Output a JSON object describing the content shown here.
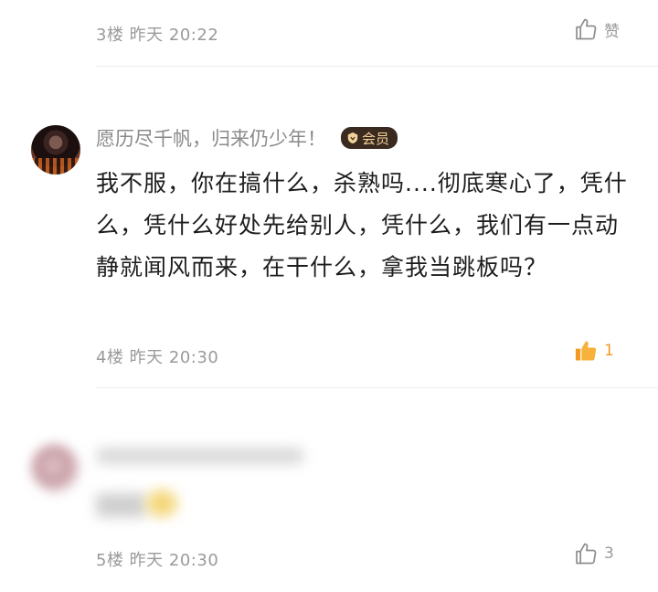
{
  "comments": [
    {
      "floor_time": "3楼 昨天 20:22",
      "like_label": "赞",
      "liked": false
    },
    {
      "username": "愿历尽千帆，归来仍少年！",
      "badge": "会员",
      "content": "我不服，你在搞什么，杀熟吗....彻底寒心了，凭什么，凭什么好处先给别人，凭什么，我们有一点动静就闻风而来，在干什么，拿我当跳板吗？",
      "floor_time": "4楼 昨天 20:30",
      "like_count": "1",
      "liked": true
    },
    {
      "floor_time": "5楼 昨天 20:30",
      "like_count": "3",
      "liked": false
    }
  ],
  "colors": {
    "meta_gray": "#9a9a9a",
    "like_orange": "#f39a25",
    "vip_bg": "#3a2a1f",
    "vip_text": "#f3d29a"
  }
}
